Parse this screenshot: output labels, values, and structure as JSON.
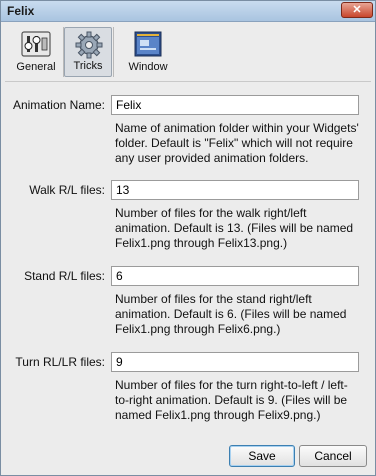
{
  "window": {
    "title": "Felix",
    "close_glyph": "✕"
  },
  "toolbar": {
    "tabs": [
      {
        "label": "General",
        "icon": "sliders-icon"
      },
      {
        "label": "Tricks",
        "icon": "gear-icon",
        "selected": true
      },
      {
        "label": "Window",
        "icon": "window-icon"
      }
    ]
  },
  "form": {
    "animation_name": {
      "label": "Animation Name:",
      "value": "Felix",
      "description": "Name of animation folder within your Widgets' folder. Default is \"Felix\" which will not require any user provided animation folders."
    },
    "walk_files": {
      "label": "Walk R/L files:",
      "value": "13",
      "description": "Number of files for the walk right/left animation. Default is 13. (Files will be named Felix1.png through Felix13.png.)"
    },
    "stand_files": {
      "label": "Stand R/L files:",
      "value": "6",
      "description": "Number of files for the stand right/left animation. Default is 6. (Files will be named Felix1.png through Felix6.png.)"
    },
    "turn_files": {
      "label": "Turn RL/LR files:",
      "value": "9",
      "description": "Number of files for the turn right-to-left / left-to-right animation. Default is 9. (Files will be named Felix1.png through Felix9.png.)"
    }
  },
  "buttons": {
    "save": "Save",
    "cancel": "Cancel"
  }
}
